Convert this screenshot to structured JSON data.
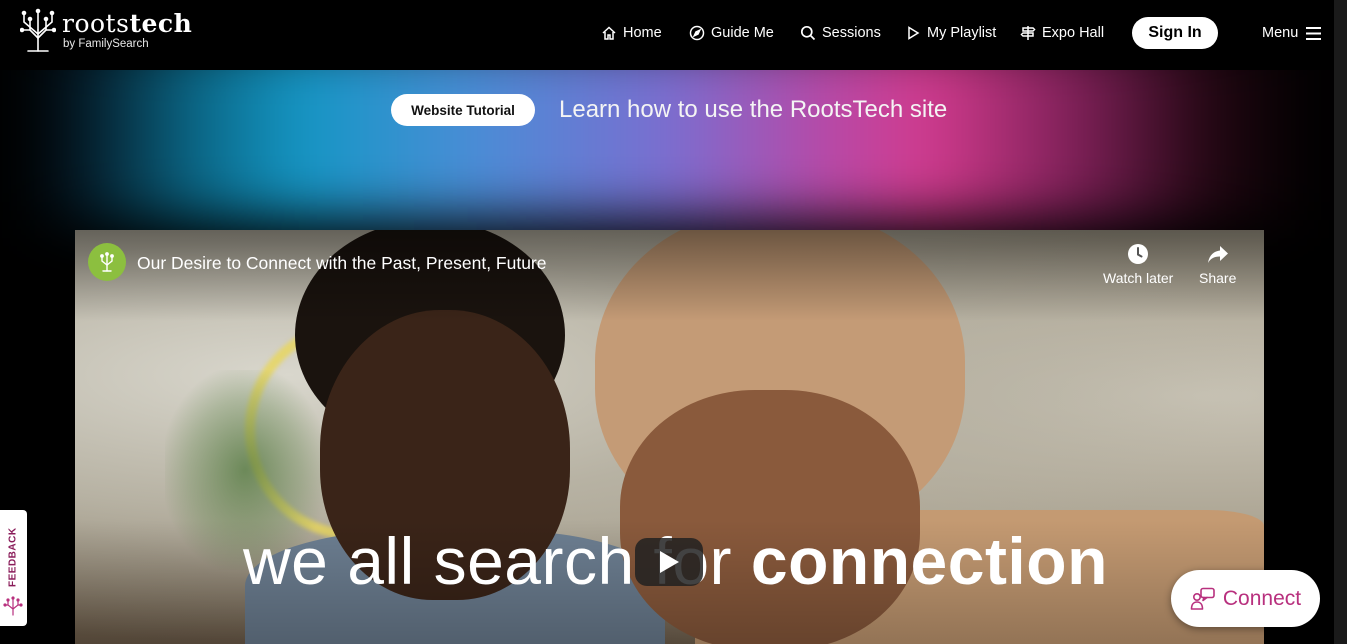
{
  "logo": {
    "word_bold": "roots",
    "word_rest": "tech",
    "sub": "by FamilySearch"
  },
  "nav": {
    "items": [
      {
        "label": "Home",
        "icon": "home-icon"
      },
      {
        "label": "Guide Me",
        "icon": "compass-icon"
      },
      {
        "label": "Sessions",
        "icon": "search-icon"
      },
      {
        "label": "My Playlist",
        "icon": "play-outline-icon"
      },
      {
        "label": "Expo Hall",
        "icon": "signpost-icon"
      }
    ],
    "signin": "Sign In",
    "menu": "Menu"
  },
  "hero": {
    "tutorial_button": "Website Tutorial",
    "tutorial_text": "Learn how to use the RootsTech site"
  },
  "video": {
    "title": "Our Desire to Connect with the Past, Present, Future",
    "watch_later": "Watch later",
    "share": "Share",
    "caption_light": "we all search for ",
    "caption_bold": "connection"
  },
  "feedback": {
    "label": "FEEDBACK"
  },
  "connect": {
    "label": "Connect"
  },
  "colors": {
    "accent_pink": "#b8307e",
    "channel_green": "#8cbf3f",
    "feedback_text": "#8a1c5a"
  }
}
